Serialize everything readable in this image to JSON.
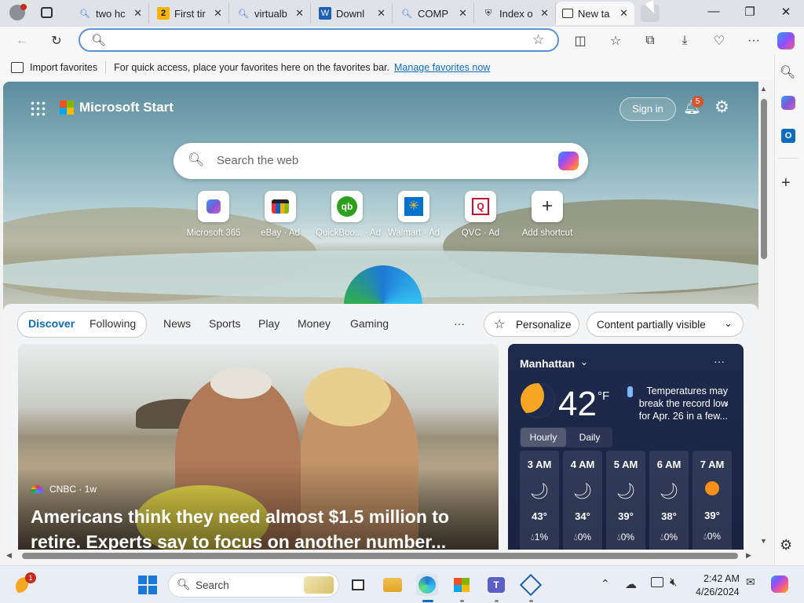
{
  "tabs": [
    {
      "favicon": "search-icon",
      "title": "two hc"
    },
    {
      "favicon": "number-two-icon",
      "title": "First tir"
    },
    {
      "favicon": "search-icon",
      "title": "virtualb"
    },
    {
      "favicon": "document-icon",
      "title": "Downl"
    },
    {
      "favicon": "search-icon",
      "title": "COMP"
    },
    {
      "favicon": "shield-icon",
      "title": "Index o"
    },
    {
      "favicon": "new-tab-icon",
      "title": "New ta"
    }
  ],
  "address": {
    "value": ""
  },
  "favorites_bar": {
    "import_label": "Import favorites",
    "message": "For quick access, place your favorites here on the favorites bar.",
    "manage_link": "Manage favorites now"
  },
  "start": {
    "brand": "Microsoft Start",
    "sign_in": "Sign in",
    "notification_count": "5",
    "search_placeholder": "Search the web",
    "quicklinks": [
      {
        "label": "Microsoft 365",
        "icon": "m365-icon",
        "color": "#7b5bd6"
      },
      {
        "label": "eBay · Ad",
        "icon": "ebay-icon",
        "color": "#e53238"
      },
      {
        "label": "QuickBoo... · Ad",
        "icon": "quickbooks-icon",
        "color": "#2ca01c"
      },
      {
        "label": "Walmart · Ad",
        "icon": "walmart-icon",
        "color": "#0071ce"
      },
      {
        "label": "QVC · Ad",
        "icon": "qvc-icon",
        "color": "#c8102e"
      },
      {
        "label": "Add shortcut",
        "icon": "plus-icon",
        "color": "#333333"
      }
    ]
  },
  "feed_nav": {
    "discover": "Discover",
    "following": "Following",
    "items": [
      "News",
      "Sports",
      "Play",
      "Money",
      "Gaming"
    ],
    "more": "···",
    "personalize": "Personalize",
    "visibility": "Content partially visible"
  },
  "article": {
    "source": "CNBC · 1w",
    "headline": "Americans think they need almost $1.5 million to retire. Experts say to focus on another number..."
  },
  "weather": {
    "location": "Manhattan",
    "temp": "42",
    "unit": "°F",
    "alert": "Temperatures may break the record low for Apr. 26 in a few...",
    "tab_hourly": "Hourly",
    "tab_daily": "Daily",
    "hours": [
      {
        "time": "3 AM",
        "icon": "moon-icon",
        "temp": "43°",
        "precip": "1%"
      },
      {
        "time": "4 AM",
        "icon": "moon-icon",
        "temp": "34°",
        "precip": "0%"
      },
      {
        "time": "5 AM",
        "icon": "moon-icon",
        "temp": "39°",
        "precip": "0%"
      },
      {
        "time": "6 AM",
        "icon": "moon-icon",
        "temp": "38°",
        "precip": "0%"
      },
      {
        "time": "7 AM",
        "icon": "sun-icon",
        "temp": "39°",
        "precip": "0%"
      }
    ]
  },
  "taskbar": {
    "search_placeholder": "Search",
    "time": "2:42 AM",
    "date": "4/26/2024",
    "weather_badge": "1"
  },
  "colors": {
    "accent": "#0f6cbd",
    "link": "#0f6cbd",
    "weather_bg": "#1f2a4a"
  }
}
